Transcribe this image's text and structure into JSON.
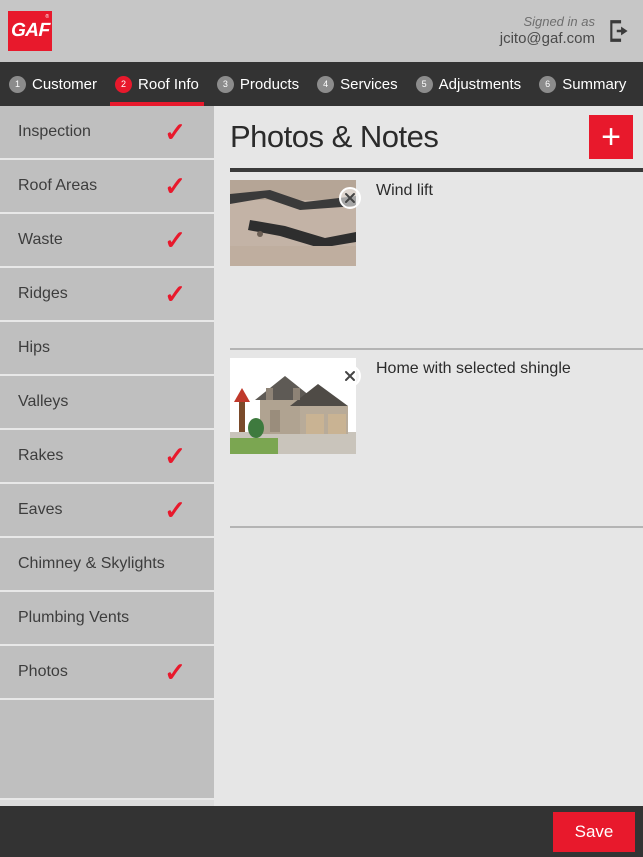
{
  "header": {
    "logo_text": "GAF",
    "logo_trademark": "®",
    "signed_in_label": "Signed in as",
    "user_email": "jcito@gaf.com",
    "signout_icon": "sign-out-icon",
    "background_color": "#c6c6c6",
    "brand_color": "#e8192c"
  },
  "tabs": [
    {
      "num": "1",
      "label": "Customer",
      "active": false
    },
    {
      "num": "2",
      "label": "Roof Info",
      "active": true
    },
    {
      "num": "3",
      "label": "Products",
      "active": false
    },
    {
      "num": "4",
      "label": "Services",
      "active": false
    },
    {
      "num": "5",
      "label": "Adjustments",
      "active": false
    },
    {
      "num": "6",
      "label": "Summary",
      "active": false
    }
  ],
  "sidebar": {
    "items": [
      {
        "label": "Inspection",
        "checked": true,
        "selected": false
      },
      {
        "label": "Roof Areas",
        "checked": true,
        "selected": false
      },
      {
        "label": "Waste",
        "checked": true,
        "selected": false
      },
      {
        "label": "Ridges",
        "checked": true,
        "selected": false
      },
      {
        "label": "Hips",
        "checked": false,
        "selected": false
      },
      {
        "label": "Valleys",
        "checked": false,
        "selected": false
      },
      {
        "label": "Rakes",
        "checked": true,
        "selected": false
      },
      {
        "label": "Eaves",
        "checked": true,
        "selected": false
      },
      {
        "label": "Chimney & Skylights",
        "checked": false,
        "selected": false
      },
      {
        "label": "Plumbing Vents",
        "checked": false,
        "selected": false
      },
      {
        "label": "Photos",
        "checked": true,
        "selected": true
      }
    ],
    "check_glyph": "✓",
    "check_color": "#e8192c"
  },
  "main": {
    "title": "Photos & Notes",
    "add_button_glyph": "+",
    "photos": [
      {
        "note": "Wind lift",
        "delete_icon": "delete-circle-icon"
      },
      {
        "note": "Home with selected shingle",
        "delete_icon": "delete-circle-icon"
      }
    ]
  },
  "footer": {
    "save_label": "Save"
  }
}
